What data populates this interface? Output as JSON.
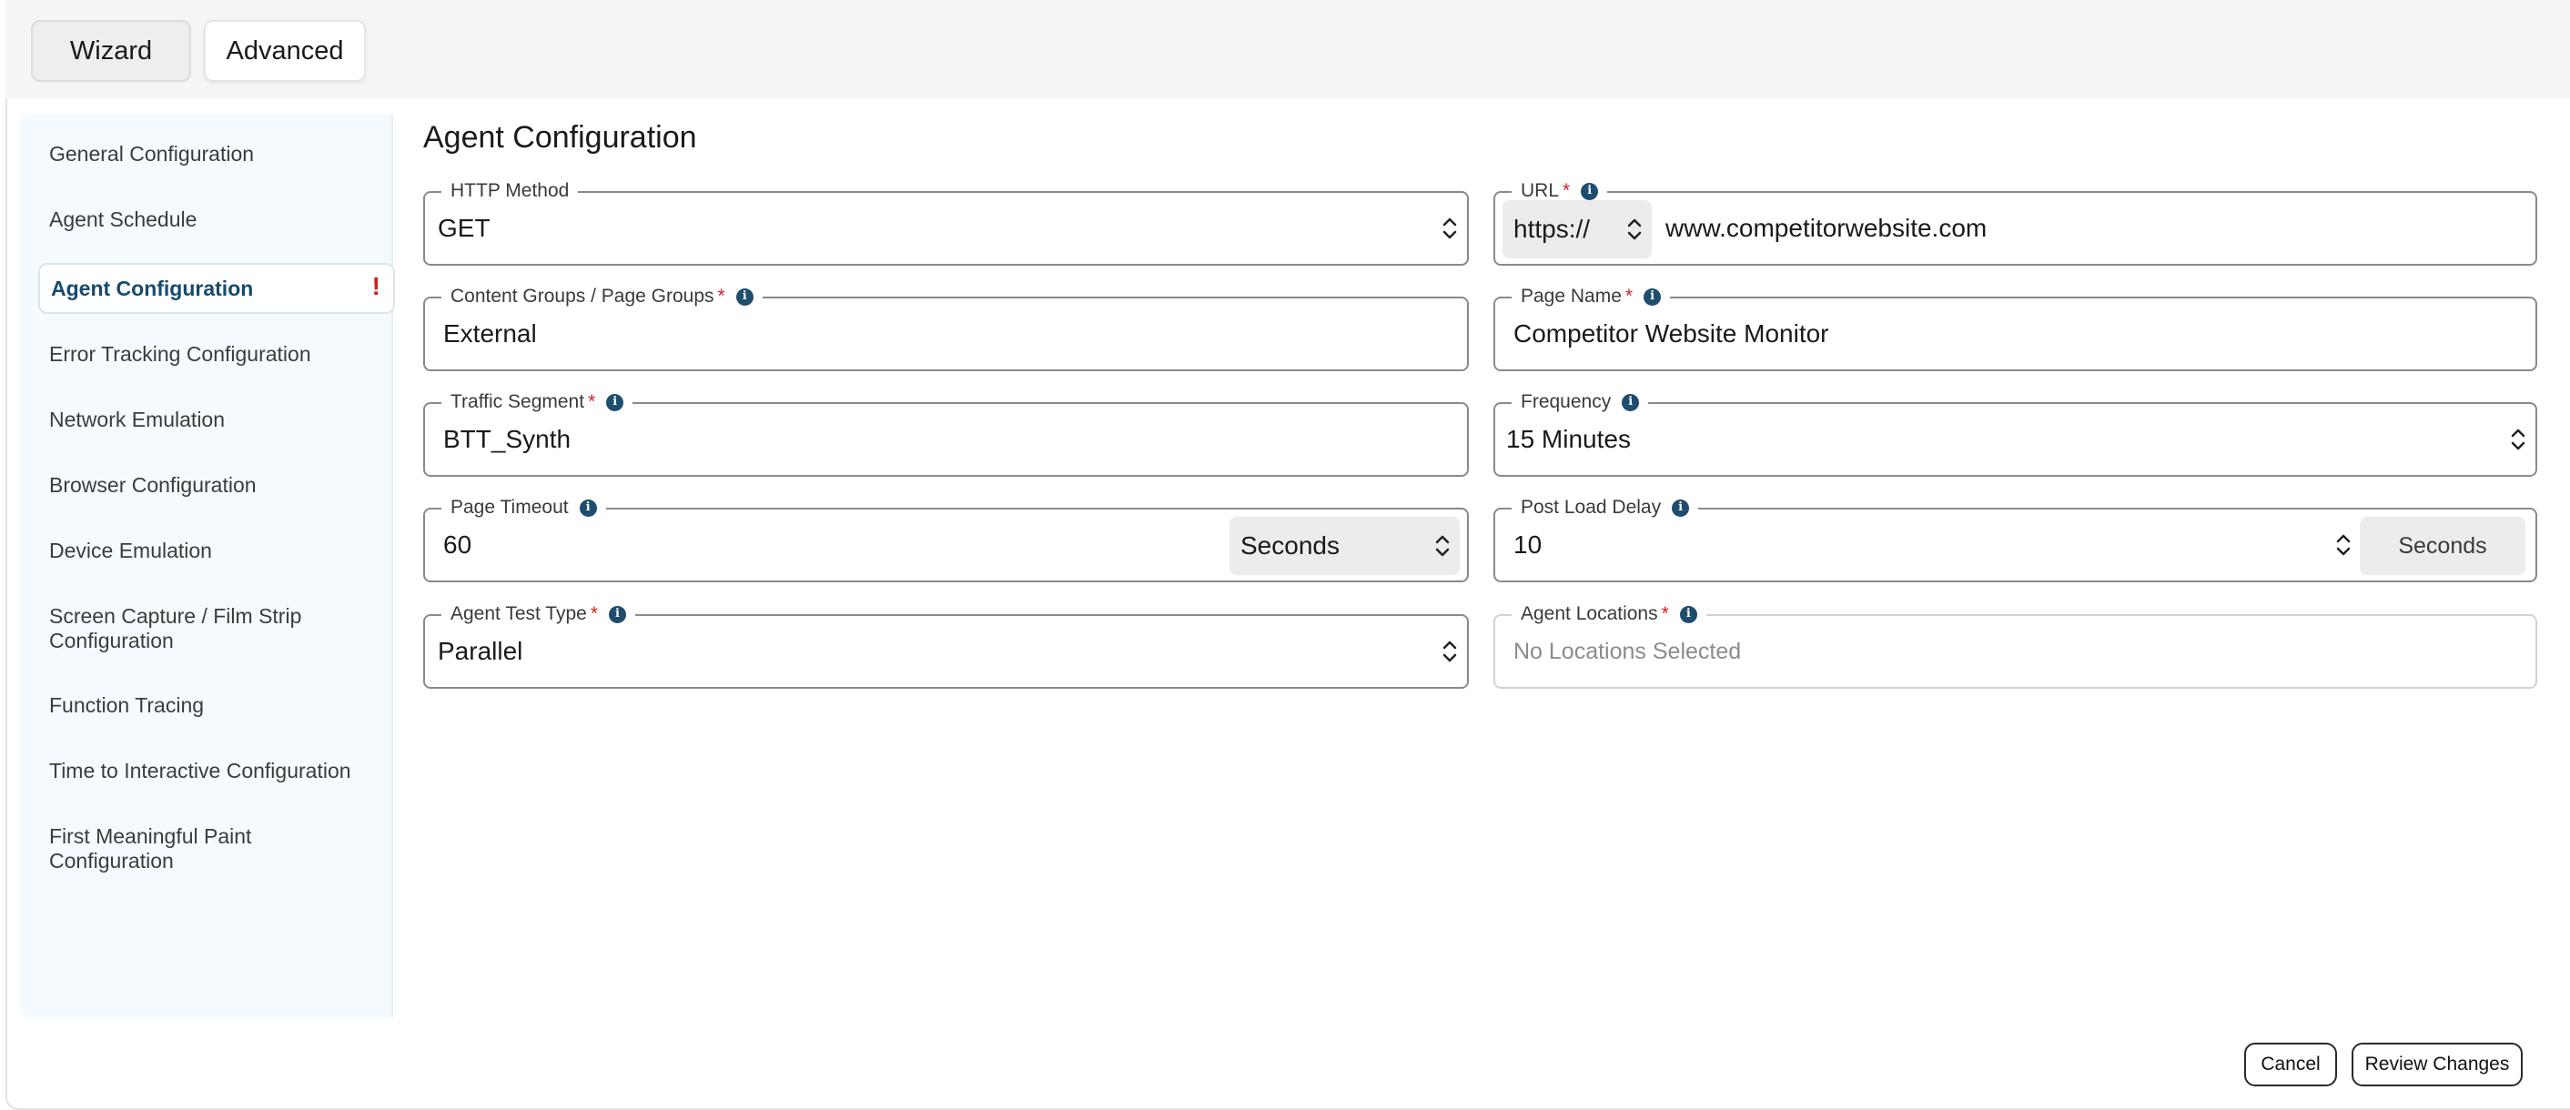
{
  "modes": {
    "wizard": "Wizard",
    "advanced": "Advanced"
  },
  "sidebar": {
    "items": [
      {
        "label": "General Configuration"
      },
      {
        "label": "Agent Schedule"
      },
      {
        "label": "Agent Configuration",
        "active": true,
        "alert": "!"
      },
      {
        "label": "Error Tracking Configuration"
      },
      {
        "label": "Network Emulation"
      },
      {
        "label": "Browser Configuration"
      },
      {
        "label": "Device Emulation"
      },
      {
        "label": "Screen Capture / Film Strip Configuration"
      },
      {
        "label": "Function Tracing"
      },
      {
        "label": "Time to Interactive Configuration"
      },
      {
        "label": "First Meaningful Paint Configuration"
      }
    ]
  },
  "section": {
    "title": "Agent Configuration"
  },
  "fields": {
    "http_method": {
      "label": "HTTP Method",
      "value": "GET"
    },
    "url": {
      "label": "URL",
      "required": "*",
      "protocol": "https://",
      "value": "www.competitorwebsite.com"
    },
    "content_groups": {
      "label": "Content Groups / Page Groups",
      "required": "*",
      "value": "External"
    },
    "page_name": {
      "label": "Page Name",
      "required": "*",
      "value": "Competitor Website Monitor"
    },
    "traffic_segment": {
      "label": "Traffic Segment",
      "required": "*",
      "value": "BTT_Synth"
    },
    "frequency": {
      "label": "Frequency",
      "value": "15 Minutes"
    },
    "page_timeout": {
      "label": "Page Timeout",
      "value": "60",
      "unit": "Seconds"
    },
    "post_load_delay": {
      "label": "Post Load Delay",
      "value": "10",
      "unit": "Seconds"
    },
    "agent_test_type": {
      "label": "Agent Test Type",
      "required": "*",
      "value": "Parallel"
    },
    "agent_locations": {
      "label": "Agent Locations",
      "required": "*",
      "placeholder": "No Locations Selected"
    }
  },
  "footer": {
    "cancel": "Cancel",
    "review": "Review Changes"
  },
  "colors": {
    "accent": "#1e4d6e",
    "required": "#d01f1f",
    "sidebar_bg": "#f4fafd"
  }
}
